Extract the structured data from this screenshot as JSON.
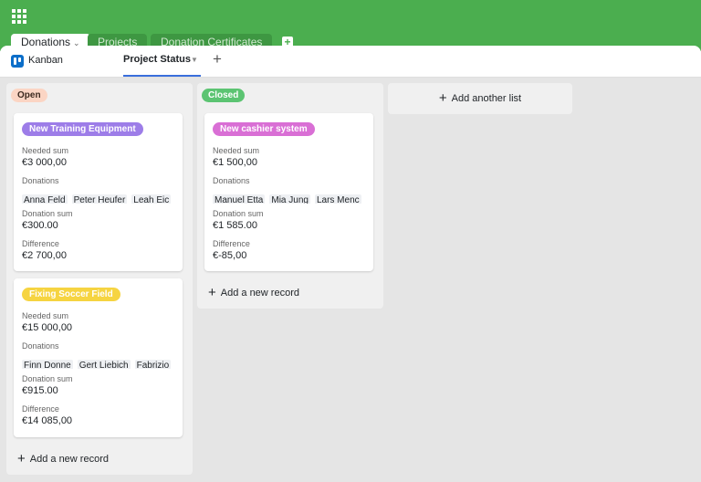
{
  "header": {
    "app_icon": "apps-grid-icon",
    "tabs": [
      {
        "label": "Donations"
      },
      {
        "label": "Projects"
      },
      {
        "label": "Donation Certificates"
      }
    ]
  },
  "viewbar": {
    "view_type_label": "Kanban",
    "current_view": "Project Status"
  },
  "board": {
    "add_record_label": "Add a new record",
    "add_list_label": "Add another list",
    "columns": [
      {
        "name": "Open",
        "color": "#fbd5c4",
        "cards": [
          {
            "title": "New Training Equipment",
            "title_color": "#9d7de8",
            "needed_label": "Needed sum",
            "needed": "€3 000,00",
            "donations_label": "Donations",
            "donations": [
              "Anna Feld",
              "Peter Heufer",
              "Leah Eic"
            ],
            "donation_sum_label": "Donation sum",
            "donation_sum": "€300.00",
            "difference_label": "Difference",
            "difference": "€2 700,00"
          },
          {
            "title": "Fixing Soccer Field",
            "title_color": "#f6d441",
            "needed_label": "Needed sum",
            "needed": "€15 000,00",
            "donations_label": "Donations",
            "donations": [
              "Finn Donne",
              "Gert Liebich",
              "Fabrizio"
            ],
            "donation_sum_label": "Donation sum",
            "donation_sum": "€915.00",
            "difference_label": "Difference",
            "difference": "€14 085,00"
          }
        ]
      },
      {
        "name": "Closed",
        "color": "#5cc472",
        "cards": [
          {
            "title": "New cashier system",
            "title_color": "#d96fd5",
            "needed_label": "Needed sum",
            "needed": "€1 500,00",
            "donations_label": "Donations",
            "donations": [
              "Manuel Etta",
              "Mia Jung",
              "Lars Menc"
            ],
            "donation_sum_label": "Donation sum",
            "donation_sum": "€1 585.00",
            "difference_label": "Difference",
            "difference": "€-85,00"
          }
        ]
      }
    ]
  }
}
